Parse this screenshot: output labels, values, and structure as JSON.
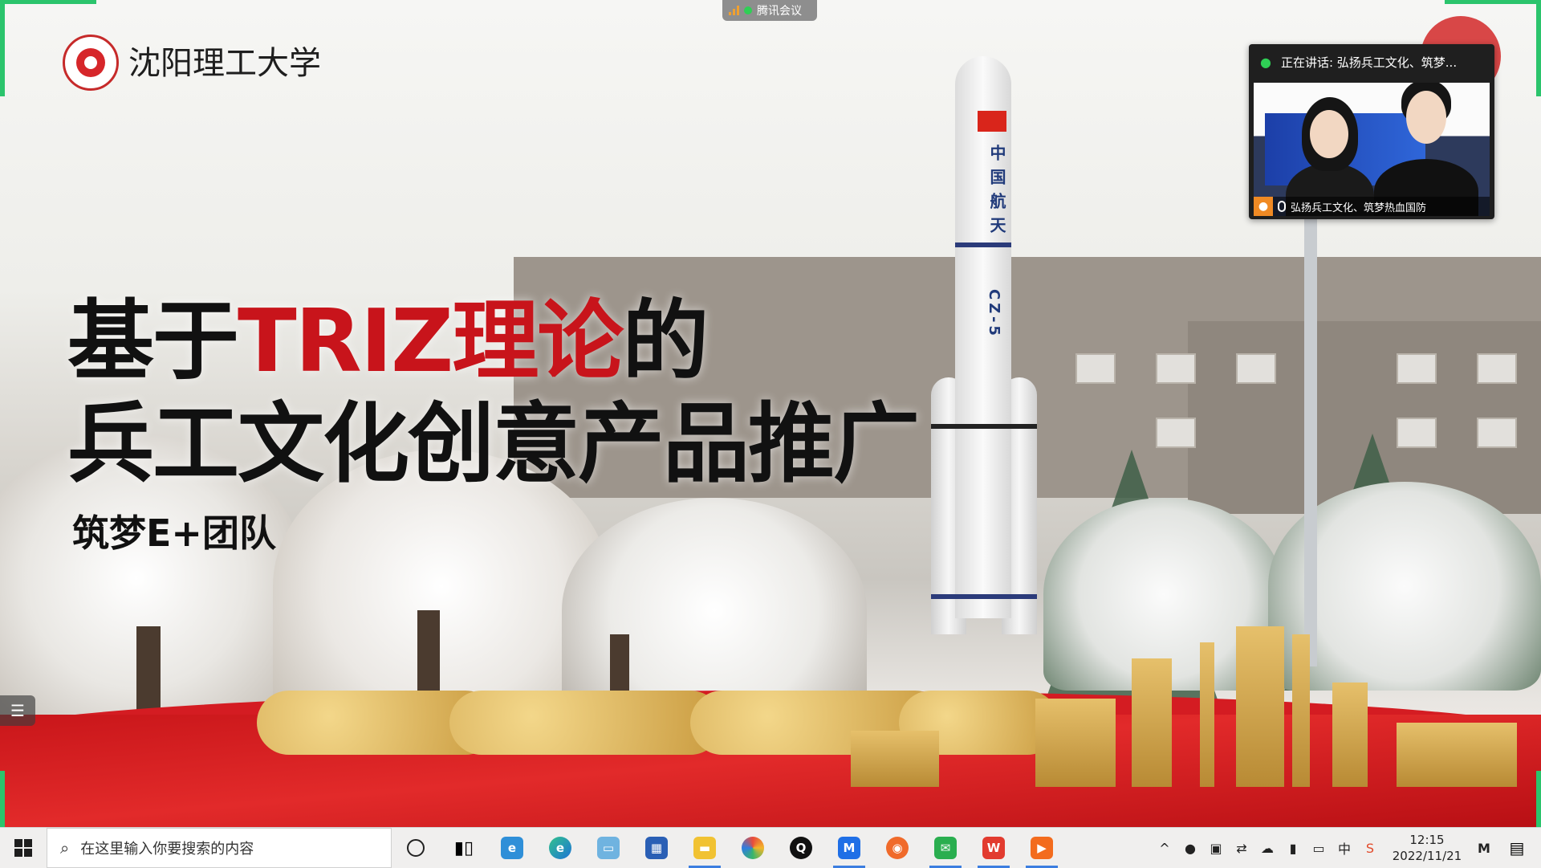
{
  "meeting": {
    "app_label": "腾讯会议"
  },
  "slide": {
    "university_name": "沈阳理工大学",
    "title_line1_pre": "基于",
    "title_line1_red": "TRIZ理论",
    "title_line1_post": "的",
    "title_line2": "兵工文化创意产品推广",
    "subtitle": "筑梦E+团队",
    "rocket_text": "中国航天",
    "rocket_model": "CZ-5",
    "accent_red": "#c8141b"
  },
  "speaker_panel": {
    "status_text": "正在讲话: 弘扬兵工文化、筑梦...",
    "participant_name": "弘扬兵工文化、筑梦热血国防"
  },
  "taskbar": {
    "search_placeholder": "在这里输入你要搜索的内容",
    "apps": [
      "cortana-icon",
      "task-view-icon",
      "ie-icon",
      "edge-icon",
      "computer-icon",
      "store-icon",
      "file-explorer-icon",
      "pinwheel-icon",
      "qq-icon",
      "tencent-meeting-icon",
      "browser-icon",
      "wechat-icon",
      "wps-icon",
      "video-player-icon"
    ],
    "tray_ime": "中",
    "time": "12:15",
    "date": "2022/11/21"
  }
}
